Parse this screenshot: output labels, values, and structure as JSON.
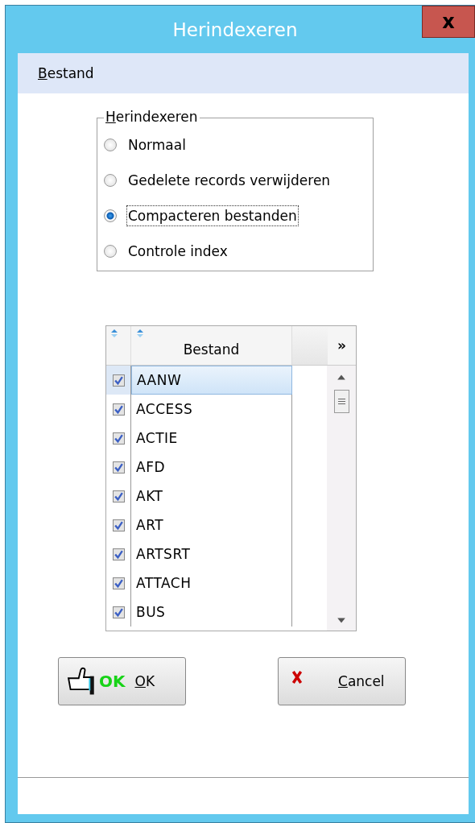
{
  "window": {
    "title": "Herindexeren",
    "close": "x"
  },
  "menu": [
    "Bestand"
  ],
  "group": {
    "title": "Herindexeren",
    "options": [
      {
        "label": "Normaal",
        "selected": false
      },
      {
        "label": "Gedelete records verwijderen",
        "selected": false
      },
      {
        "label": "Compacteren bestanden",
        "selected": true
      },
      {
        "label": "Controle index",
        "selected": false
      }
    ]
  },
  "table": {
    "column": "Bestand",
    "more": "»",
    "rows": [
      {
        "name": "AANW",
        "checked": true,
        "selected": true
      },
      {
        "name": "ACCESS",
        "checked": true,
        "selected": false
      },
      {
        "name": "ACTIE",
        "checked": true,
        "selected": false
      },
      {
        "name": "AFD",
        "checked": true,
        "selected": false
      },
      {
        "name": "AKT",
        "checked": true,
        "selected": false
      },
      {
        "name": "ART",
        "checked": true,
        "selected": false
      },
      {
        "name": "ARTSRT",
        "checked": true,
        "selected": false
      },
      {
        "name": "ATTACH",
        "checked": true,
        "selected": false
      },
      {
        "name": "BUS",
        "checked": true,
        "selected": false
      }
    ]
  },
  "buttons": [
    {
      "kind": "ok",
      "icon_text": "OK",
      "label": "OK"
    },
    {
      "kind": "cancel",
      "label": "Cancel"
    }
  ]
}
